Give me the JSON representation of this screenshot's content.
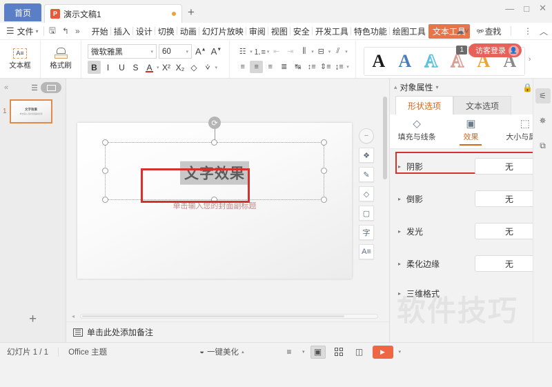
{
  "titlebar": {
    "home_tab": "首页",
    "doc_tab": {
      "label": "演示文稿1",
      "icon": "wps-presentation-icon",
      "modified_dot": "●"
    },
    "new_tab_icon": "+",
    "minimize_icon": "—",
    "maximize_icon": "□",
    "close_icon": "✕",
    "notification_count": "1",
    "login_label": "访客登录",
    "avatar_icon": "user-avatar-icon"
  },
  "menu": {
    "hamburger_icon": "hamburger-menu-icon",
    "file_label": "文件",
    "save_icon": "save-icon",
    "undo_icon": "undo-icon",
    "more_icon": "»",
    "tabs": [
      "开始",
      "插入",
      "设计",
      "切换",
      "动画",
      "幻灯片放映",
      "审阅",
      "视图",
      "安全",
      "开发工具",
      "特色功能",
      "绘图工具"
    ],
    "active_tab": "文本工具",
    "find_label": "查找",
    "find_icon": "search-icon",
    "right_icons": [
      "cloud-icon",
      "collaborate-icon",
      "share-icon",
      "more-options-icon",
      "collapse-ribbon-icon"
    ]
  },
  "toolbar": {
    "textbox_label": "文本框",
    "textbox_icon": "textbox-icon",
    "format_brush_label": "格式刷",
    "format_brush_icon": "format-brush-icon",
    "font_name": "微软雅黑",
    "font_size": "60",
    "grow_font_icon": "A⁺",
    "shrink_font_icon": "A⁻",
    "bold": "B",
    "italic": "I",
    "underline": "U",
    "strikethrough": "S",
    "font_color": "A",
    "superscript": "X²",
    "subscript": "X₂",
    "clear_format_icon": "clear-format-icon",
    "text_highlight_icon": "text-highlight-icon",
    "bullets_icon": "bullet-list-icon",
    "numbering_icon": "numbered-list-icon",
    "decrease_indent_icon": "decrease-indent-icon",
    "increase_indent_icon": "increase-indent-icon",
    "text_direction_icon": "text-direction-icon",
    "align_text_icon": "align-text-icon",
    "columns_icon": "columns-icon",
    "align_left_icon": "align-left-icon",
    "align_center_icon": "align-center-icon",
    "align_right_icon": "align-right-icon",
    "justify_icon": "justify-icon",
    "distribute_icon": "distribute-icon",
    "line_spacing_icon": "line-spacing-icon",
    "paragraph_spacing_icon": "paragraph-spacing-icon",
    "spacing_options_icon": "spacing-options-icon",
    "wordart_styles": [
      {
        "name": "wordart-black",
        "glyph": "A",
        "color": "#1a1a1a",
        "style": "solid"
      },
      {
        "name": "wordart-blue",
        "glyph": "A",
        "color": "#4a7ebb",
        "style": "solid"
      },
      {
        "name": "wordart-lightblue-outline",
        "glyph": "A",
        "color": "#5bc0de",
        "style": "outline"
      },
      {
        "name": "wordart-salmon-outline",
        "glyph": "A",
        "color": "#d99d92",
        "style": "outline"
      },
      {
        "name": "wordart-orange",
        "glyph": "A",
        "color": "#e8a33d",
        "style": "solid"
      },
      {
        "name": "wordart-gray",
        "glyph": "A",
        "color": "#8a8a8a",
        "style": "solid"
      }
    ],
    "wordart_more_icon": "›"
  },
  "thumbnails": {
    "collapse_icon": "«",
    "outline_view_icon": "outline-view-icon",
    "slide_view_icon": "slide-view-icon",
    "slides": [
      {
        "number": "1",
        "title": "文字效果",
        "subtitle": "单击输入您的封面副标题"
      }
    ],
    "add_slide_icon": "+"
  },
  "slide": {
    "title_text": "文字效果",
    "subtitle_text": "单击输入您的封面副标题",
    "rotate_handle_icon": "rotate-handle-icon",
    "float_tools": [
      {
        "name": "collapse-tools-icon",
        "glyph": "−"
      },
      {
        "name": "layers-icon",
        "glyph": "layers"
      },
      {
        "name": "brush-icon",
        "glyph": "brush"
      },
      {
        "name": "shape-fill-icon",
        "glyph": "fill"
      },
      {
        "name": "shape-outline-icon",
        "glyph": "outline"
      },
      {
        "name": "text-settings-icon",
        "glyph": "字"
      },
      {
        "name": "text-align-icon",
        "glyph": "A"
      }
    ]
  },
  "notes": {
    "placeholder": "单击此处添加备注",
    "icon": "notes-icon"
  },
  "panel": {
    "title": "对象属性",
    "title_caret": "▾",
    "lock_icon": "lock-icon",
    "close_icon": "✕",
    "tabs": [
      {
        "label": "形状选项",
        "active": true
      },
      {
        "label": "文本选项",
        "active": false
      }
    ],
    "subtabs": [
      {
        "label": "填充与线条",
        "icon": "fill-line-icon",
        "active": false
      },
      {
        "label": "效果",
        "icon": "effects-icon",
        "active": true
      },
      {
        "label": "大小与属性",
        "icon": "size-properties-icon",
        "active": false
      }
    ],
    "properties": [
      {
        "label": "阴影",
        "value": "无",
        "highlighted": true
      },
      {
        "label": "倒影",
        "value": "无",
        "highlighted": false
      },
      {
        "label": "发光",
        "value": "无",
        "highlighted": false
      },
      {
        "label": "柔化边缘",
        "value": "无",
        "highlighted": false
      }
    ],
    "property_3d": {
      "label": "三维格式"
    },
    "side_icons": [
      {
        "name": "properties-icon",
        "active": true
      },
      {
        "name": "animation-icon",
        "active": false
      },
      {
        "name": "selection-pane-icon",
        "active": false
      }
    ]
  },
  "watermark": "软件技巧",
  "status": {
    "slide_count": "幻灯片 1 / 1",
    "theme": "Office 主题",
    "beautify_label": "一键美化",
    "beautify_icon": "magic-icon",
    "beautify_caret": "▴",
    "view_note_icon": "view-notes-icon",
    "view_normal_icon": "normal-view-icon",
    "view_sorter_icon": "slide-sorter-icon",
    "view_reading_icon": "reading-view-icon",
    "play_icon": "▶",
    "play_caret": "▾"
  },
  "colors": {
    "accent": "#d2691e",
    "brand_red": "#e8593a",
    "highlight_red": "#d6312c",
    "home_tab_blue": "#5b7fc7",
    "play_orange": "#ee6644"
  }
}
